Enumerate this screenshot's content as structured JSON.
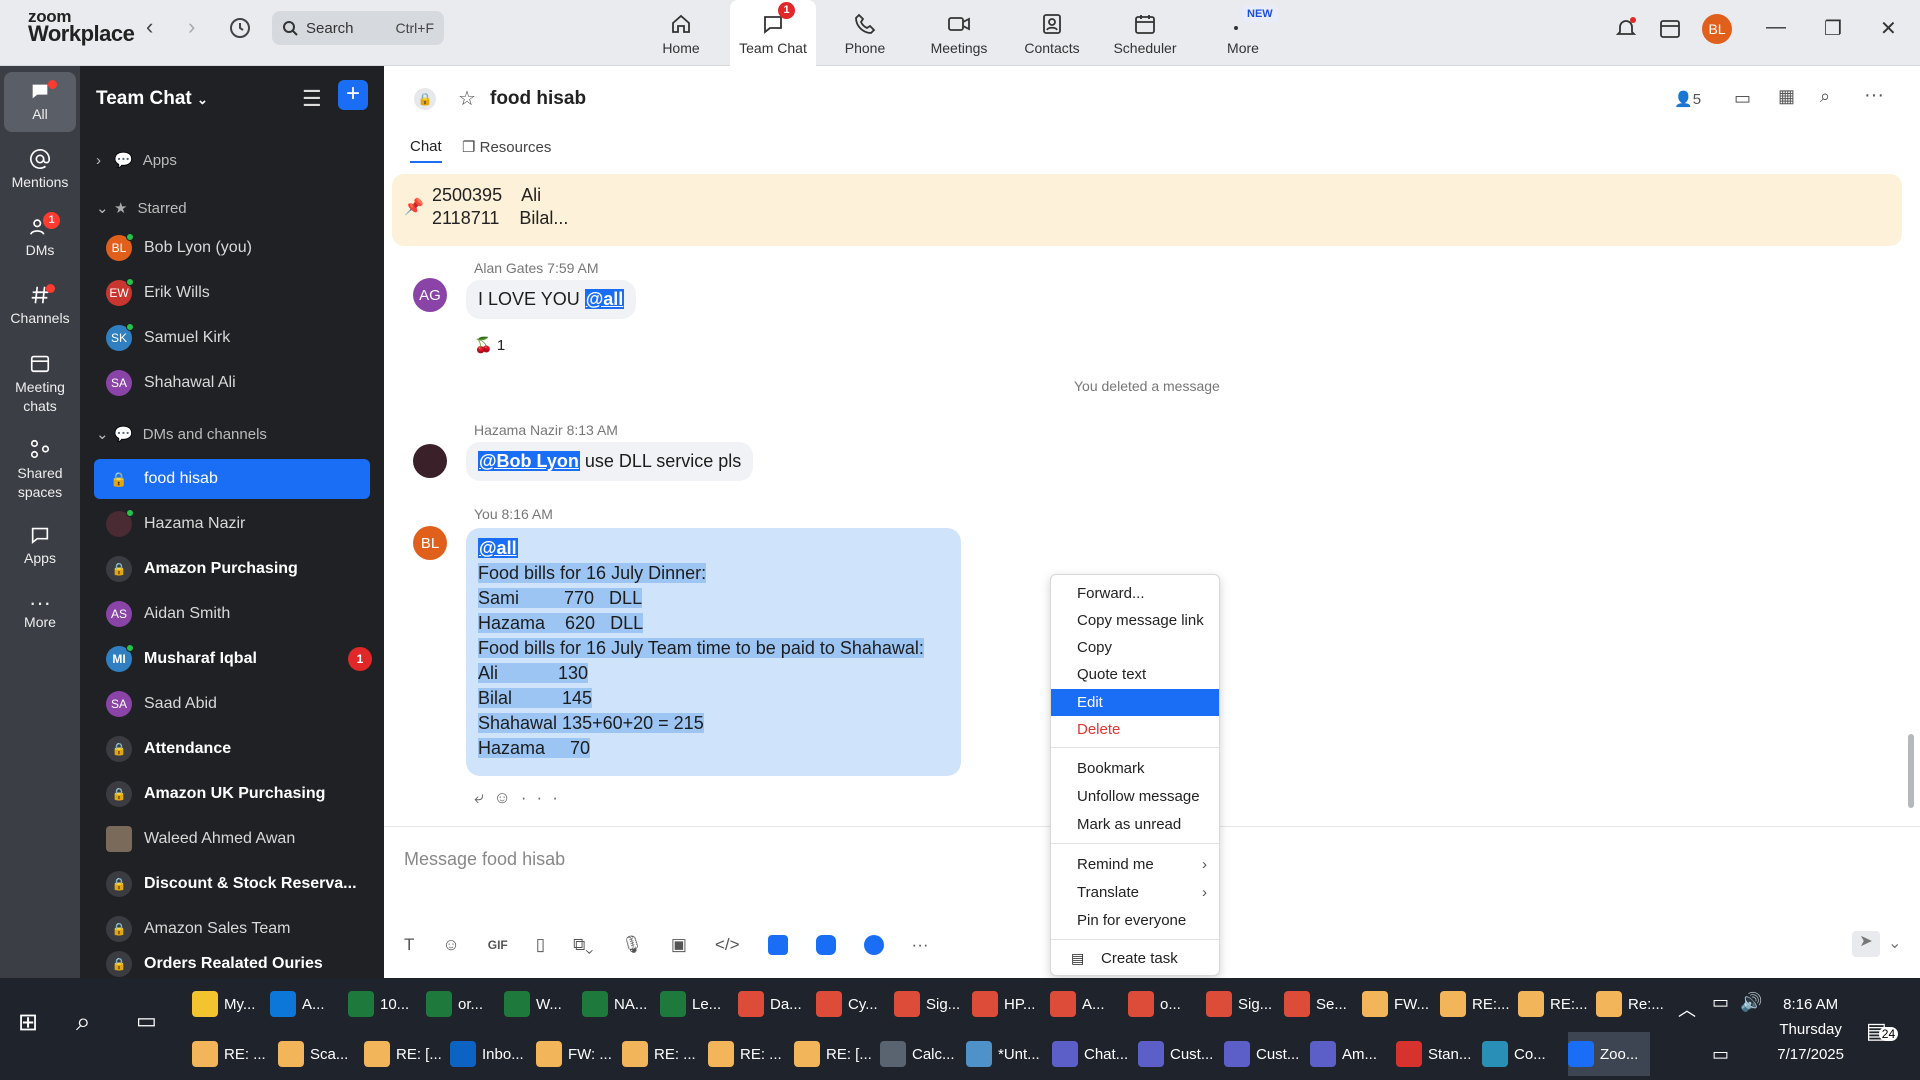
{
  "topbar": {
    "logo_top": "zoom",
    "logo_bottom": "Workplace",
    "search_label": "Search",
    "search_shortcut": "Ctrl+F",
    "tabs": [
      {
        "label": "Home"
      },
      {
        "label": "Team Chat",
        "badge": "1"
      },
      {
        "label": "Phone"
      },
      {
        "label": "Meetings"
      },
      {
        "label": "Contacts"
      },
      {
        "label": "Scheduler"
      },
      {
        "label": "More",
        "tag": "NEW"
      }
    ],
    "avatar": "BL"
  },
  "rail": {
    "items": [
      {
        "label": "All"
      },
      {
        "label": "Mentions"
      },
      {
        "label": "DMs",
        "badge": "1"
      },
      {
        "label": "Channels"
      },
      {
        "label": "Meeting chats"
      },
      {
        "label": "Shared spaces"
      },
      {
        "label": "Apps"
      },
      {
        "label": "More"
      }
    ]
  },
  "sidebar": {
    "title": "Team Chat",
    "apps_label": "Apps",
    "starred_label": "Starred",
    "starred": [
      {
        "initials": "BL",
        "name": "Bob Lyon (you)",
        "color": "#e0601b"
      },
      {
        "initials": "EW",
        "name": "Erik Wills",
        "color": "#c9362f"
      },
      {
        "initials": "SK",
        "name": "Samuel Kirk",
        "color": "#2f7fc1"
      },
      {
        "initials": "SA",
        "name": "Shahawal Ali",
        "color": "#8a44a8"
      }
    ],
    "dms_label": "DMs and channels",
    "dms": [
      {
        "name": "food hisab",
        "type": "lock"
      },
      {
        "name": "Hazama Nazir",
        "type": "photo"
      },
      {
        "name": "Amazon Purchasing",
        "type": "lock"
      },
      {
        "initials": "AS",
        "name": "Aidan Smith",
        "color": "#8a44a8"
      },
      {
        "initials": "MI",
        "name": "Musharaf Iqbal",
        "color": "#2f7fc1",
        "unread": "1"
      },
      {
        "initials": "SA",
        "name": "Saad Abid",
        "color": "#8a44a8"
      },
      {
        "name": "Attendance",
        "type": "lock"
      },
      {
        "name": "Amazon UK Purchasing",
        "type": "lock"
      },
      {
        "name": "Waleed Ahmed Awan",
        "type": "photo"
      },
      {
        "name": "Discount & Stock Reserva...",
        "type": "lock"
      },
      {
        "name": "Amazon Sales Team",
        "type": "lock"
      },
      {
        "name": "Orders Realated Ouries",
        "type": "lock"
      }
    ]
  },
  "chat": {
    "title": "food hisab",
    "members_count": "5",
    "tabs": [
      "Chat",
      "Resources"
    ],
    "pinned": {
      "line1": "2500395    Ali",
      "line2": "2118711    Bilal..."
    },
    "messages": [
      {
        "sender": "Alan Gates",
        "time": "7:59 AM",
        "initials": "AG",
        "text": "I LOVE YOU ",
        "mention": "@all",
        "reaction": "1"
      },
      {
        "system": "You deleted a message"
      },
      {
        "sender": "Hazama Nazir",
        "time": "8:13 AM",
        "mention": "@Bob Lyon",
        "text": " use DLL service pls"
      },
      {
        "sender": "You",
        "time": "8:16 AM",
        "initials": "BL",
        "lines": [
          "@all",
          "Food bills for 16 July Dinner:",
          "Sami         770   DLL",
          "Hazama    620   DLL",
          "Food bills for 16 July Team time to be paid to Shahawal:",
          "Ali            130",
          "Bilal          145",
          "Shahawal 135+60+20 = 215",
          "Hazama     70"
        ]
      }
    ],
    "composer_placeholder": "Message food hisab"
  },
  "context_menu": {
    "items": [
      "Forward...",
      "Copy message link",
      "Copy",
      "Quote text",
      "Edit",
      "Delete",
      "Bookmark",
      "Unfollow message",
      "Mark as unread",
      "Remind me",
      "Translate",
      "Pin for everyone",
      "Create task"
    ]
  },
  "taskbar": {
    "row1": [
      "My...",
      "A...",
      "10...",
      "or...",
      "W...",
      "NA...",
      "Le...",
      "Da...",
      "Cy...",
      "Sig...",
      "HP...",
      "A...",
      "o...",
      "Sig...",
      "Se...",
      "FW...",
      "RE:...",
      "RE:...",
      "Re:..."
    ],
    "row2": [
      "RE: ...",
      "Sca...",
      "RE: [...",
      "Inbo...",
      "FW: ...",
      "RE: ...",
      "RE: ...",
      "RE: [...",
      "Calc...",
      "*Unt...",
      "Chat...",
      "Cust...",
      "Cust...",
      "Am...",
      "Stan...",
      "Co...",
      "Zoo..."
    ],
    "time": "8:16 AM",
    "day": "Thursday",
    "date": "7/17/2025",
    "notif_count": "24"
  }
}
